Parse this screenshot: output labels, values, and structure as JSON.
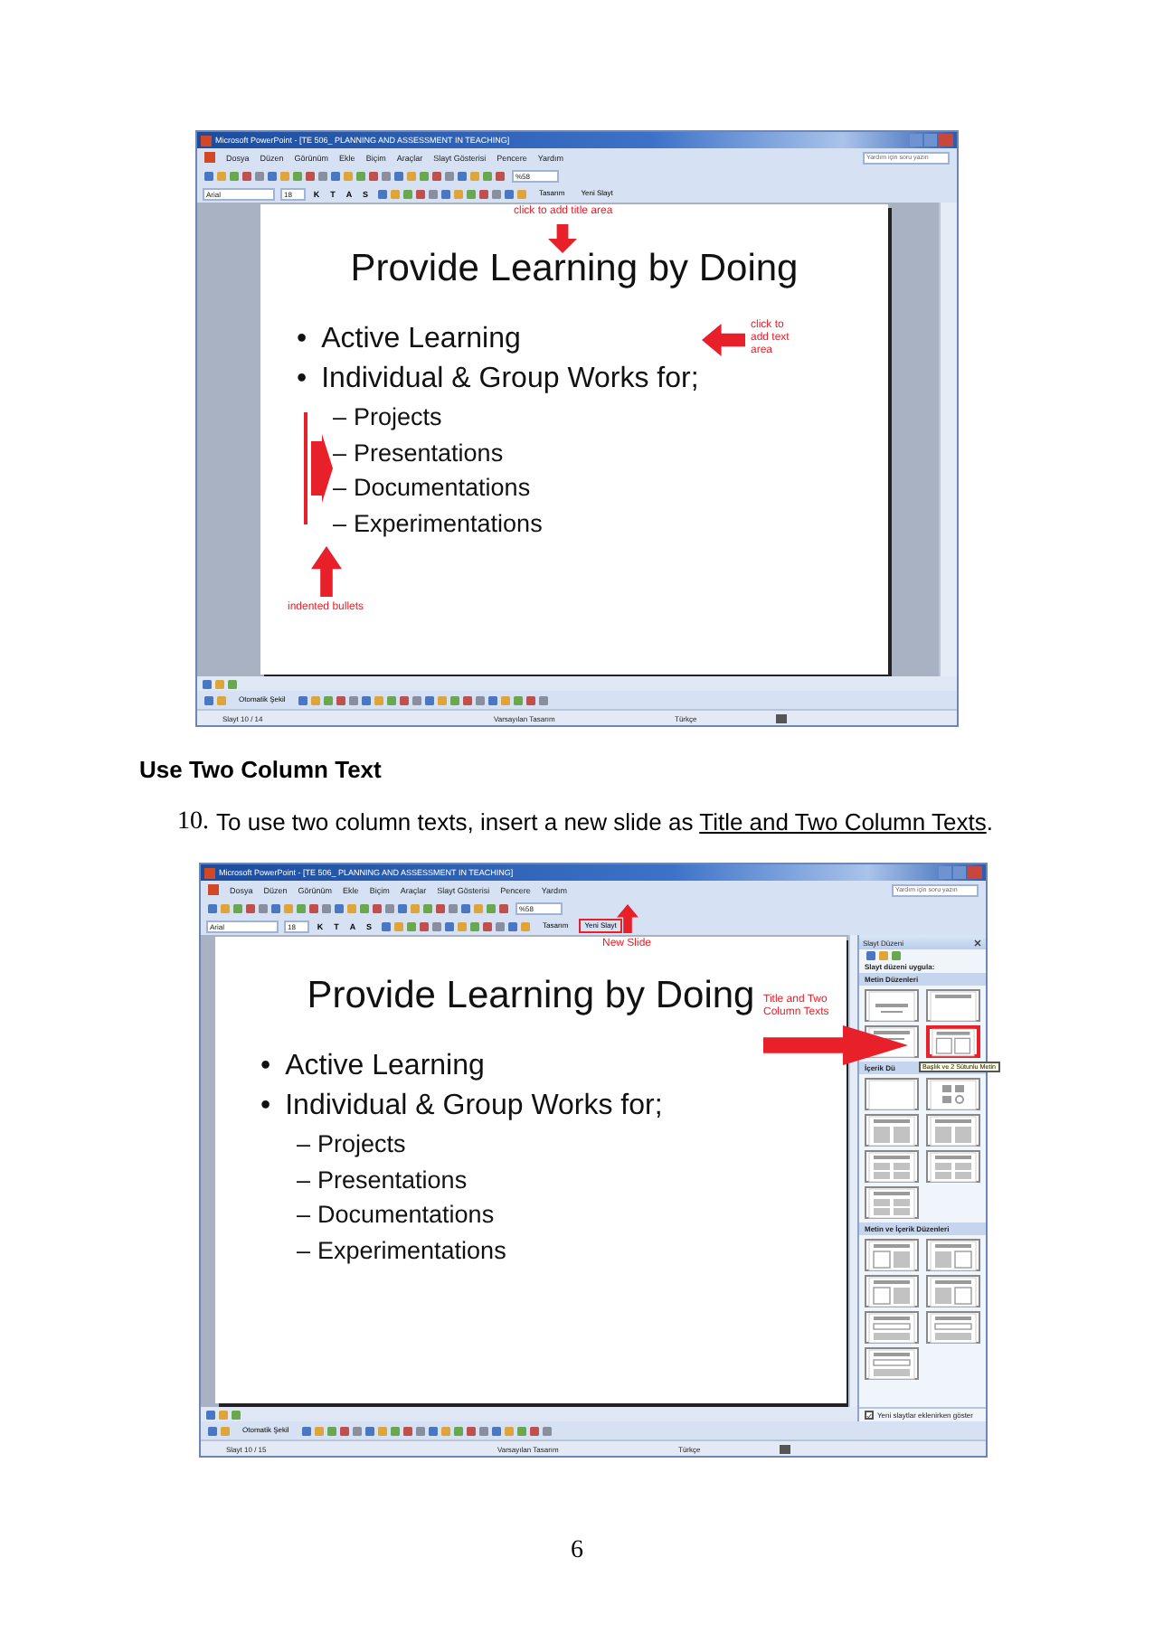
{
  "screenshots": [
    {
      "window": {
        "title": "Microsoft PowerPoint - [TE 506_ PLANNING AND ASSESSMENT IN TEACHING]"
      },
      "menu": [
        "Dosya",
        "Düzen",
        "Görünüm",
        "Ekle",
        "Biçim",
        "Araçlar",
        "Slayt Gösterisi",
        "Pencere",
        "Yardım"
      ],
      "help_box": {
        "placeholder": "Yardım için soru yazın"
      },
      "standard_toolbar": {
        "zoom": "%58"
      },
      "formatting_toolbar": {
        "font": "Arial",
        "size": "18",
        "style_buttons": [
          "K",
          "T",
          "A",
          "S"
        ],
        "buttons": [
          {
            "label": "Tasarım",
            "highlighted": false
          },
          {
            "label": "Yeni Slayt",
            "highlighted": false
          }
        ]
      },
      "slide": {
        "title": "Provide Learning by Doing",
        "bullets": [
          {
            "marker": "•",
            "text": "Active Learning"
          },
          {
            "marker": "•",
            "text": "Individual & Group Works for;",
            "children": [
              {
                "marker": "–",
                "text": "Projects"
              },
              {
                "marker": "–",
                "text": "Presentations"
              },
              {
                "marker": "–",
                "text": "Documentations"
              },
              {
                "marker": "–",
                "text": "Experimentations"
              }
            ]
          }
        ]
      },
      "annotations": [
        {
          "kind": "down",
          "text": "click to add title area"
        },
        {
          "kind": "left",
          "text": "click to add text area"
        },
        {
          "kind": "up",
          "text": "indented bullets"
        },
        {
          "kind": "bracket"
        }
      ],
      "drawing_toolbar": {
        "autoshapes": "Otomatik Şekil"
      },
      "status_bar": [
        "Slayt 10 / 14",
        "Varsayılan Tasarım",
        "Türkçe"
      ]
    },
    {
      "window": {
        "title": "Microsoft PowerPoint - [TE 506_ PLANNING AND ASSESSMENT IN TEACHING]"
      },
      "menu": [
        "Dosya",
        "Düzen",
        "Görünüm",
        "Ekle",
        "Biçim",
        "Araçlar",
        "Slayt Gösterisi",
        "Pencere",
        "Yardım"
      ],
      "help_box": {
        "placeholder": "Yardım için soru yazın"
      },
      "standard_toolbar": {
        "zoom": "%58"
      },
      "formatting_toolbar": {
        "font": "Arial",
        "size": "18",
        "style_buttons": [
          "K",
          "T",
          "A",
          "S"
        ],
        "buttons": [
          {
            "label": "Tasarım",
            "highlighted": false
          },
          {
            "label": "Yeni Slayt",
            "highlighted": true
          }
        ]
      },
      "slide": {
        "title": "Provide Learning by Doing",
        "bullets": [
          {
            "marker": "•",
            "text": "Active Learning"
          },
          {
            "marker": "•",
            "text": "Individual & Group Works for;",
            "children": [
              {
                "marker": "–",
                "text": "Projects"
              },
              {
                "marker": "–",
                "text": "Presentations"
              },
              {
                "marker": "–",
                "text": "Documentations"
              },
              {
                "marker": "–",
                "text": "Experimentations"
              }
            ]
          }
        ]
      },
      "annotations": [
        {
          "kind": "up",
          "text": "New Slide"
        },
        {
          "kind": "right",
          "text": "Title and Two Column Texts"
        }
      ],
      "task_pane": {
        "title": "Slayt Düzeni",
        "apply_label": "Slayt düzeni uygula:",
        "sections": [
          {
            "title": "Metin Düzenleri",
            "layouts": [
              {
                "kind": "title-slide",
                "selected": false
              },
              {
                "kind": "title-only",
                "selected": false
              },
              {
                "kind": "text",
                "selected": false
              },
              {
                "kind": "two-column",
                "selected": true,
                "tooltip": "Başlık ve 2 Sütunlu Metin"
              }
            ]
          },
          {
            "title": "İçerik Dü",
            "layouts": [
              {
                "kind": "blank",
                "selected": false
              },
              {
                "kind": "content",
                "selected": false
              },
              {
                "kind": "two-content",
                "selected": false
              },
              {
                "kind": "two-content",
                "selected": false
              },
              {
                "kind": "multi-content",
                "selected": false
              },
              {
                "kind": "multi-content",
                "selected": false
              },
              {
                "kind": "multi-content",
                "selected": false
              }
            ]
          },
          {
            "title": "Metin ve İçerik Düzenleri",
            "layouts": [
              {
                "kind": "text-content",
                "selected": false
              },
              {
                "kind": "content-text",
                "selected": false
              },
              {
                "kind": "text-content",
                "selected": false
              },
              {
                "kind": "content-text",
                "selected": false
              },
              {
                "kind": "text-over-content",
                "selected": false
              },
              {
                "kind": "text-over-content",
                "selected": false
              },
              {
                "kind": "text-over-content",
                "selected": false
              }
            ]
          }
        ],
        "show_option": {
          "label": "Yeni slaytlar eklenirken göster",
          "checked": true
        }
      },
      "drawing_toolbar": {
        "autoshapes": "Otomatik Şekil"
      },
      "status_bar": [
        "Slayt 10 / 15",
        "Varsayılan Tasarım",
        "Türkçe"
      ]
    }
  ],
  "heading": "Use Two Column Text",
  "steps": [
    {
      "number": "10.",
      "text": "To use two column texts, insert a new slide as ",
      "link": "Title and Two Column Texts",
      "after": "."
    }
  ],
  "page_number": "6"
}
